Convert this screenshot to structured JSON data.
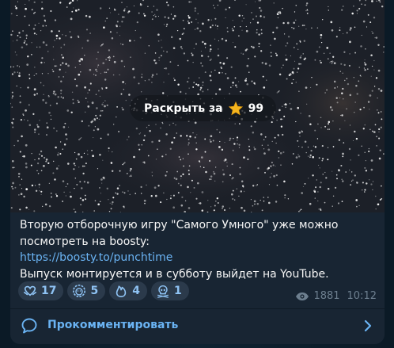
{
  "post": {
    "reveal_label": "Раскрыть за",
    "reveal_price": "99",
    "caption_line1": "Вторую отборочную игру \"Самого Умного\" уже можно",
    "caption_line2": "посмотреть на boosty:",
    "caption_link": "https://boosty.to/punchtime",
    "caption_line4": "Выпуск монтируется и в субботу выйдет на YouTube."
  },
  "reactions": [
    {
      "icon": "heart-hands-icon",
      "count": "17"
    },
    {
      "icon": "lion-face-icon",
      "count": "5"
    },
    {
      "icon": "fire-icon",
      "count": "4"
    },
    {
      "icon": "skull-crossbones-icon",
      "count": "1"
    }
  ],
  "meta": {
    "views": "1881",
    "time": "10:12"
  },
  "comments": {
    "label": "Прокомментировать"
  },
  "colors": {
    "accent": "#6ab3f3",
    "bubble": "#182533",
    "background": "#0e1621"
  }
}
